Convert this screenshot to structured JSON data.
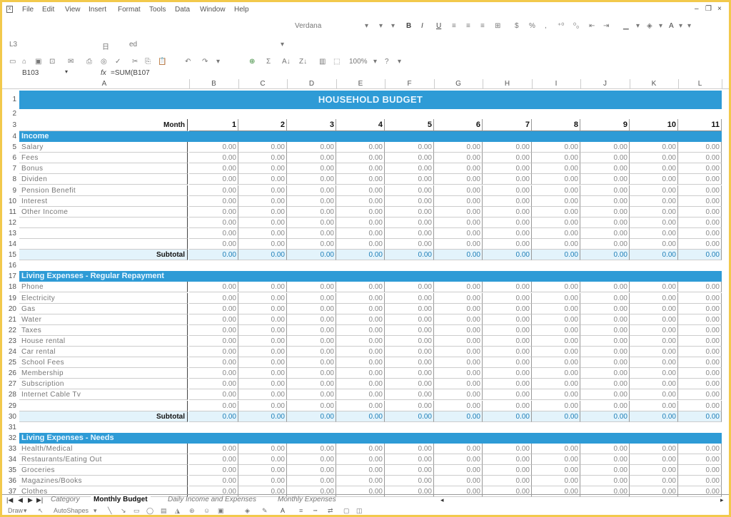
{
  "menubar": {
    "items": [
      "File",
      "Edit",
      "View",
      "Insert",
      "Format",
      "Tools",
      "Data",
      "Window",
      "Help"
    ],
    "window_controls": [
      "–",
      "❐",
      "×"
    ]
  },
  "toolbar1": {
    "font_name": "Verdana",
    "format_buttons": [
      "B",
      "I",
      "U",
      "$",
      "%",
      ","
    ]
  },
  "toolbar2": {
    "items": [
      "L3",
      "日",
      "ed"
    ]
  },
  "toolbar3": {
    "zoom": "100%"
  },
  "formulabar": {
    "name_box": "B103",
    "fx_label": "fx",
    "formula": "=SUM(B107"
  },
  "columns": [
    "A",
    "B",
    "C",
    "D",
    "E",
    "F",
    "G",
    "H",
    "I",
    "J",
    "K",
    "L"
  ],
  "sheet": {
    "title": "HOUSEHOLD BUDGET",
    "month_label": "Month",
    "months": [
      "1",
      "2",
      "3",
      "4",
      "5",
      "6",
      "7",
      "8",
      "9",
      "10",
      "11"
    ],
    "zero_value": "0.00",
    "subtotal_label": "Subtotal",
    "sections": [
      {
        "name": "Income",
        "header_row": "4",
        "items": [
          {
            "row": "5",
            "label": "Salary"
          },
          {
            "row": "6",
            "label": "Fees"
          },
          {
            "row": "7",
            "label": "Bonus"
          },
          {
            "row": "8",
            "label": "Dividen"
          },
          {
            "row": "9",
            "label": "Pension Benefit"
          },
          {
            "row": "10",
            "label": "Interest"
          },
          {
            "row": "11",
            "label": "Other Income"
          },
          {
            "row": "12",
            "label": ""
          },
          {
            "row": "13",
            "label": ""
          },
          {
            "row": "14",
            "label": ""
          }
        ],
        "subtotal_row": "15"
      },
      {
        "name": "Living Expenses - Regular Repayment",
        "header_row": "17",
        "items": [
          {
            "row": "18",
            "label": "Phone"
          },
          {
            "row": "19",
            "label": "Electricity"
          },
          {
            "row": "20",
            "label": "Gas"
          },
          {
            "row": "21",
            "label": "Water"
          },
          {
            "row": "22",
            "label": "Taxes"
          },
          {
            "row": "23",
            "label": "House rental"
          },
          {
            "row": "24",
            "label": "Car rental"
          },
          {
            "row": "25",
            "label": "School Fees"
          },
          {
            "row": "26",
            "label": "Membership"
          },
          {
            "row": "27",
            "label": "Subscription"
          },
          {
            "row": "28",
            "label": "Internet Cable Tv"
          },
          {
            "row": "29",
            "label": ""
          }
        ],
        "subtotal_row": "30"
      },
      {
        "name": "Living Expenses - Needs",
        "header_row": "32",
        "items": [
          {
            "row": "33",
            "label": "Health/Medical"
          },
          {
            "row": "34",
            "label": "Restaurants/Eating Out"
          },
          {
            "row": "35",
            "label": "Groceries"
          },
          {
            "row": "36",
            "label": "Magazines/Books"
          },
          {
            "row": "37",
            "label": "Clothes"
          }
        ]
      }
    ]
  },
  "sheet_tabs": [
    "Category",
    "Monthly Budget",
    "Daily Income and Expenses",
    "Monthly Expenses"
  ],
  "active_tab": "Monthly Budget",
  "drawbar": {
    "draw_label": "Draw",
    "autoshapes_label": "AutoShapes"
  },
  "colors": {
    "accent": "#2e9bd6",
    "subtotal_bg": "#e3f3fb",
    "frame": "#f2c94c"
  }
}
